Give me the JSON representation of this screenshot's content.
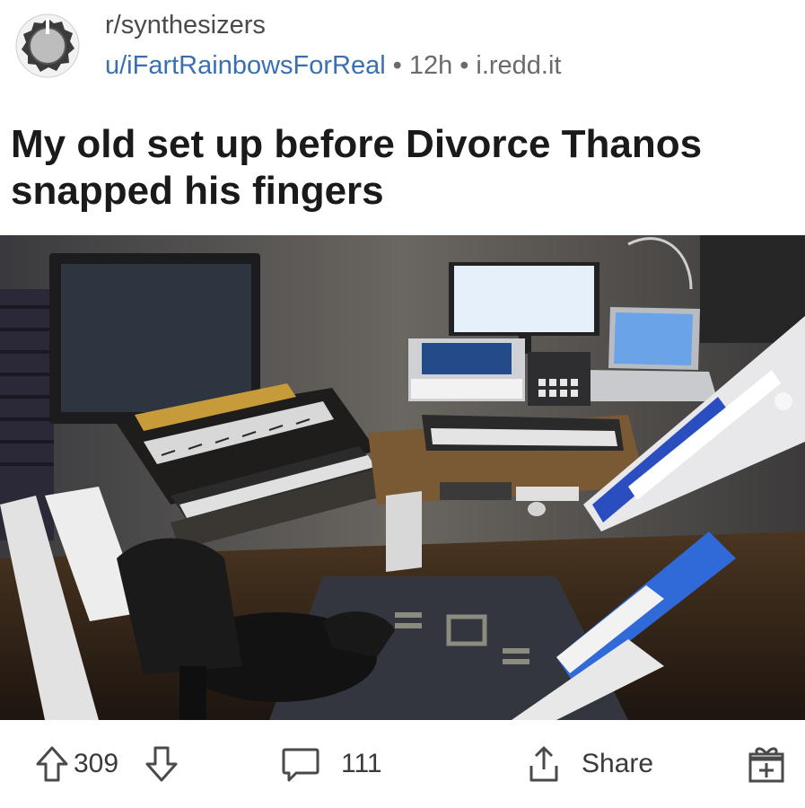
{
  "post": {
    "subreddit": "r/synthesizers",
    "author": "u/iFartRainbowsForReal",
    "separator": "•",
    "age": "12h",
    "domain": "i.redd.it",
    "title": "My old set up before Divorce Thanos snapped his fingers",
    "image_description_icon": "photo-of-synth-studio"
  },
  "actions": {
    "upvote_icon": "arrow-up-icon",
    "score": "309",
    "downvote_icon": "arrow-down-icon",
    "comments_icon": "comment-bubble-icon",
    "comments_count": "111",
    "share_icon": "share-icon",
    "share_label": "Share",
    "award_icon": "gift-award-icon"
  },
  "colors": {
    "author_link": "#3a6fb3",
    "text_primary": "#1a1a1b",
    "text_secondary": "#6b6b6d"
  }
}
